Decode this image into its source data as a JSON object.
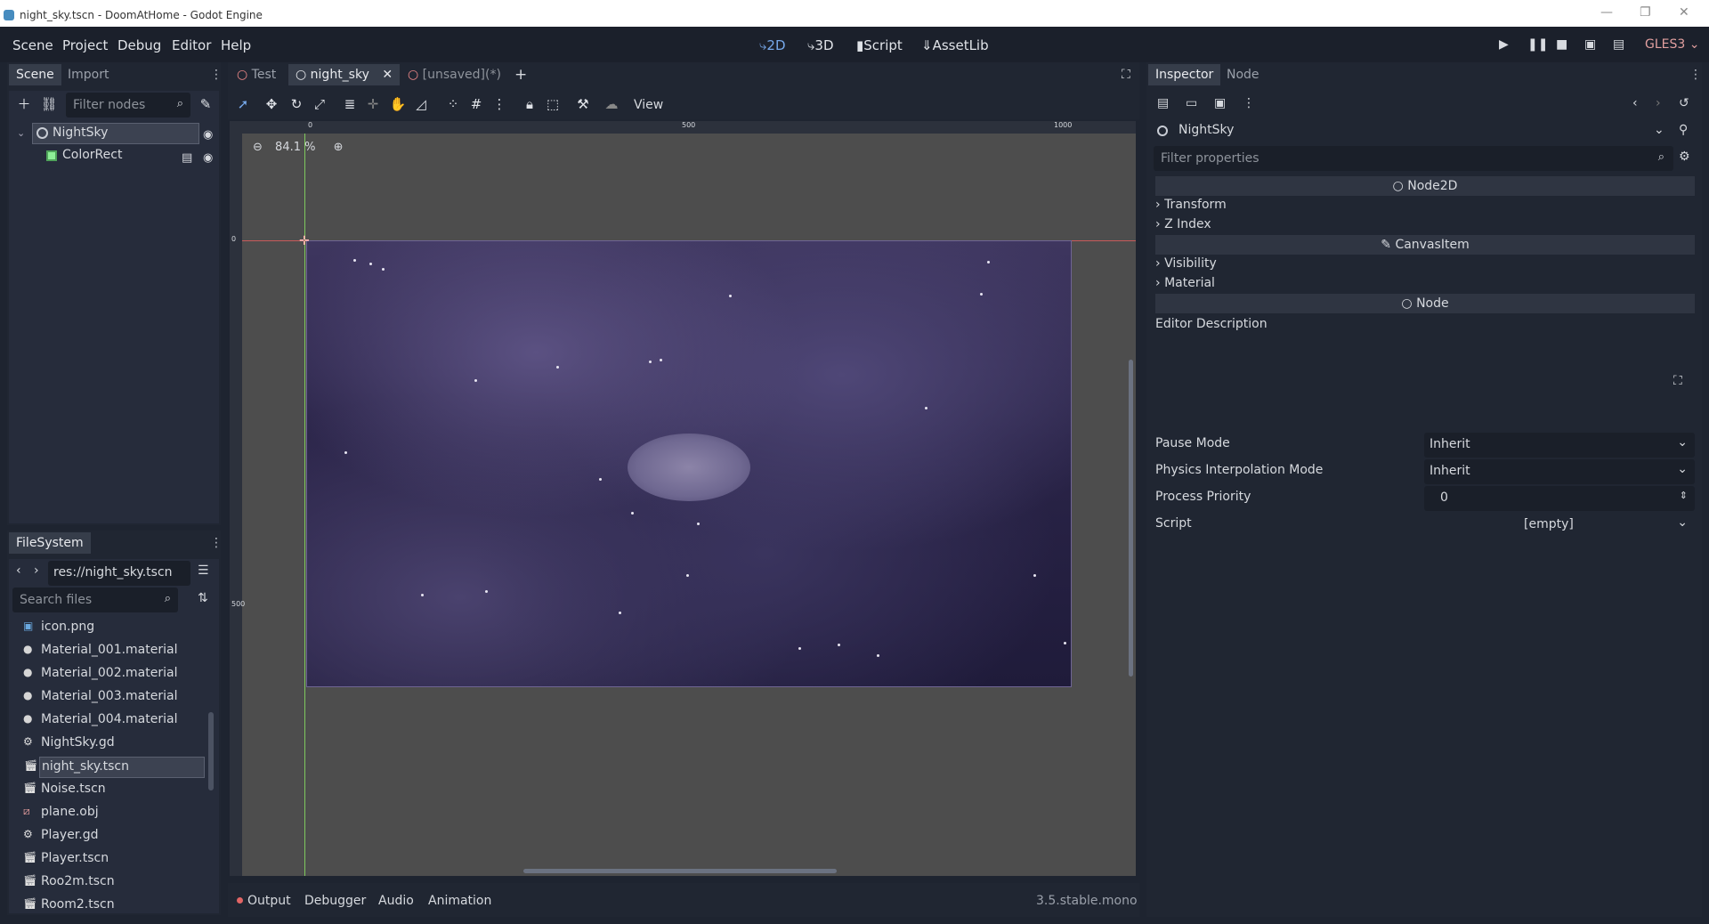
{
  "window": {
    "title": "night_sky.tscn - DoomAtHome - Godot Engine"
  },
  "menu": {
    "items": [
      "Scene",
      "Project",
      "Debug",
      "Editor",
      "Help"
    ]
  },
  "workspaces": {
    "2d": "2D",
    "3d": "3D",
    "script": "Script",
    "assetlib": "AssetLib"
  },
  "renderer": "GLES3",
  "scene_dock": {
    "tab_scene": "Scene",
    "tab_import": "Import",
    "filter_placeholder": "Filter nodes",
    "nodes": [
      {
        "label": "NightSky"
      },
      {
        "label": "ColorRect"
      }
    ]
  },
  "filesystem": {
    "tab": "FileSystem",
    "path": "res://night_sky.tscn",
    "search_placeholder": "Search files",
    "files": [
      {
        "label": "icon.png",
        "icon": "image-icon"
      },
      {
        "label": "Material_001.material",
        "icon": "material-icon"
      },
      {
        "label": "Material_002.material",
        "icon": "material-icon"
      },
      {
        "label": "Material_003.material",
        "icon": "material-icon"
      },
      {
        "label": "Material_004.material",
        "icon": "material-icon"
      },
      {
        "label": "NightSky.gd",
        "icon": "script-gear-icon"
      },
      {
        "label": "night_sky.tscn",
        "icon": "scene-icon"
      },
      {
        "label": "Noise.tscn",
        "icon": "scene-icon"
      },
      {
        "label": "plane.obj",
        "icon": "mesh-icon"
      },
      {
        "label": "Player.gd",
        "icon": "script-gear-icon"
      },
      {
        "label": "Player.tscn",
        "icon": "scene-icon"
      },
      {
        "label": "Roo2m.tscn",
        "icon": "scene-icon"
      },
      {
        "label": "Room2.tscn",
        "icon": "scene-icon"
      }
    ]
  },
  "editor_tabs": [
    {
      "label": "Test"
    },
    {
      "label": "night_sky"
    },
    {
      "label": "[unsaved](*)"
    }
  ],
  "canvas_toolbar": {
    "view_label": "View"
  },
  "viewport": {
    "zoom": "84.1 %",
    "ruler_h": [
      "0",
      "500",
      "1000"
    ],
    "ruler_v": [
      "0",
      "500"
    ]
  },
  "bottom_panel": {
    "tabs": [
      "Output",
      "Debugger",
      "Audio",
      "Animation"
    ],
    "version": "3.5.stable.mono"
  },
  "inspector": {
    "tab_inspector": "Inspector",
    "tab_node": "Node",
    "node_name": "NightSky",
    "filter_placeholder": "Filter properties",
    "section_node2d": "Node2D",
    "transform": "Transform",
    "z_index": "Z Index",
    "section_canvasitem": "CanvasItem",
    "visibility": "Visibility",
    "material": "Material",
    "section_node": "Node",
    "editor_description": "Editor Description",
    "pause_mode": {
      "label": "Pause Mode",
      "value": "Inherit"
    },
    "physics_interp": {
      "label": "Physics Interpolation Mode",
      "value": "Inherit"
    },
    "process_priority": {
      "label": "Process Priority",
      "value": "0"
    },
    "script": {
      "label": "Script",
      "value": "[empty]"
    }
  }
}
